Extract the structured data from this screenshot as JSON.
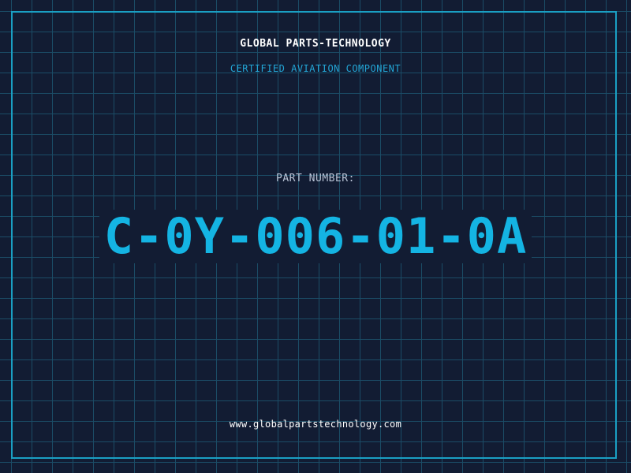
{
  "company_name": "GLOBAL PARTS-TECHNOLOGY",
  "subtitle": "CERTIFIED AVIATION COMPONENT",
  "part_label": "PART NUMBER:",
  "part_number": "C-0Y-006-01-0A",
  "website": "www.globalpartstechnology.com",
  "colors": {
    "background": "#121c33",
    "grid": "#1b4c66",
    "accent": "#14b4e3",
    "frame": "#1a9fc3"
  }
}
